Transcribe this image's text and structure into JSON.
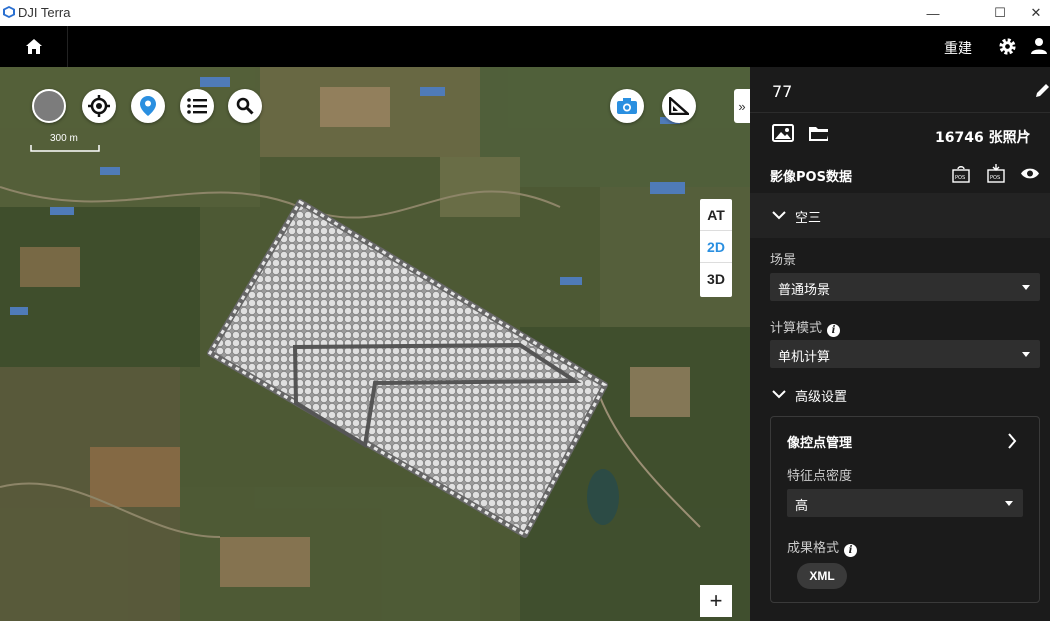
{
  "window": {
    "title": "DJI Terra",
    "minimize": "—",
    "maximize": "☐",
    "close": "✕"
  },
  "topbar": {
    "rebuild_label": "重建"
  },
  "map": {
    "scale_label": "300 m",
    "view_modes": [
      "AT",
      "2D",
      "3D"
    ],
    "active_view": "2D",
    "zoom_in": "+",
    "collapse": "»"
  },
  "panel": {
    "project_name": "77",
    "photo_count": "16746 张照片",
    "pos_title": "影像POS数据",
    "section_aerotri": "空三",
    "scene_label": "场景",
    "scene_value": "普通场景",
    "compute_mode_label": "计算模式",
    "compute_mode_value": "单机计算",
    "advanced_label": "高级设置",
    "gcp_label": "像控点管理",
    "feature_density_label": "特征点密度",
    "feature_density_value": "高",
    "output_format_label": "成果格式",
    "output_format_value": "XML"
  },
  "colors": {
    "accent": "#2a8fe0",
    "panel_bg": "#1b1b1b",
    "topbar_bg": "#000000"
  }
}
